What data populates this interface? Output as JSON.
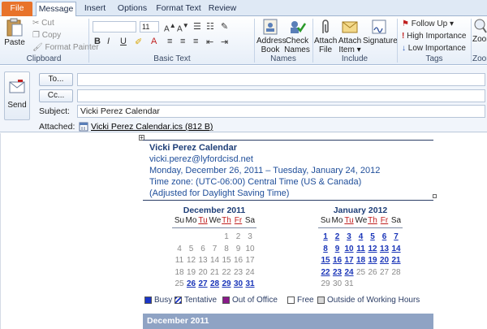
{
  "tabs": [
    "File",
    "Message",
    "Insert",
    "Options",
    "Format Text",
    "Review"
  ],
  "clipboard": {
    "paste": "Paste",
    "cut": "Cut",
    "copy": "Copy",
    "format_painter": "Format Painter",
    "label": "Clipboard"
  },
  "basic_text": {
    "font_size": "11",
    "label": "Basic Text"
  },
  "names": {
    "address_book": [
      "Address",
      "Book"
    ],
    "check_names": [
      "Check",
      "Names"
    ],
    "label": "Names"
  },
  "include": {
    "attach_file": [
      "Attach",
      "File"
    ],
    "attach_item": [
      "Attach",
      "Item"
    ],
    "signature": "Signature",
    "label": "Include"
  },
  "tags": {
    "follow_up": "Follow Up",
    "high_importance": "High Importance",
    "low_importance": "Low Importance",
    "label": "Tags"
  },
  "zoom": {
    "label": "Zoom",
    "button": "Zoom"
  },
  "compose": {
    "send": "Send",
    "to_button": "To...",
    "cc_button": "Cc...",
    "to_value": "",
    "cc_value": "",
    "subject_label": "Subject:",
    "subject_value": "Vicki Perez Calendar",
    "attached_label": "Attached:",
    "attachment": "Vicki Perez Calendar.ics (812 B)"
  },
  "body": {
    "title": "Vicki Perez Calendar",
    "email": "vicki.perez@lyfordcisd.net",
    "date_range": "Monday, December 26, 2011 – Tuesday, January 24, 2012",
    "timezone": "Time zone: (UTC-06:00) Central Time (US & Canada)",
    "dst": "(Adjusted for Daylight Saving Time)"
  },
  "calendar": {
    "weekdays": [
      "Su",
      "Mo",
      "Tu",
      "We",
      "Th",
      "Fr",
      "Sa"
    ],
    "months": [
      {
        "name": "December 2011",
        "weeks": [
          [
            "",
            "",
            "",
            "",
            "1",
            "2",
            "3"
          ],
          [
            "4",
            "5",
            "6",
            "7",
            "8",
            "9",
            "10"
          ],
          [
            "11",
            "12",
            "13",
            "14",
            "15",
            "16",
            "17"
          ],
          [
            "18",
            "19",
            "20",
            "21",
            "22",
            "23",
            "24"
          ],
          [
            "25",
            "26",
            "27",
            "28",
            "29",
            "30",
            "31"
          ]
        ],
        "busy_from": 26
      },
      {
        "name": "January 2012",
        "weeks": [
          [
            "1",
            "2",
            "3",
            "4",
            "5",
            "6",
            "7"
          ],
          [
            "8",
            "9",
            "10",
            "11",
            "12",
            "13",
            "14"
          ],
          [
            "15",
            "16",
            "17",
            "18",
            "19",
            "20",
            "21"
          ],
          [
            "22",
            "23",
            "24",
            "25",
            "26",
            "27",
            "28"
          ],
          [
            "29",
            "30",
            "31",
            "",
            "",
            "",
            ""
          ]
        ],
        "busy_to": 24
      }
    ]
  },
  "legend": [
    {
      "label": "Busy",
      "color": "#1a35c8"
    },
    {
      "label": "Tentative",
      "color": "#1a35c8"
    },
    {
      "label": "Out of Office",
      "color": "#8a1a8a"
    },
    {
      "label": "Free",
      "color": "#ffffff"
    },
    {
      "label": "Outside of Working Hours",
      "color": "#d8d8d8"
    }
  ],
  "month_bar": "December 2011"
}
